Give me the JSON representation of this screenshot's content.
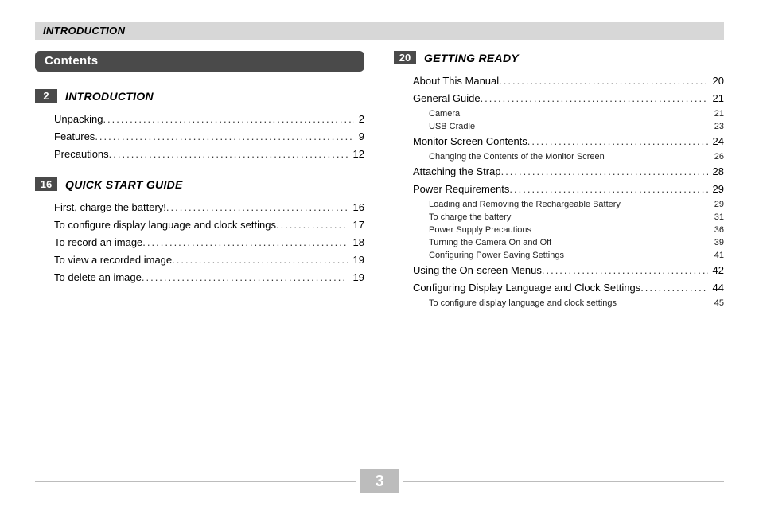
{
  "header": "INTRODUCTION",
  "contents_heading": "Contents",
  "page_number": "3",
  "left_sections": [
    {
      "badge": "2",
      "title": "INTRODUCTION",
      "entries": [
        {
          "label": "Unpacking",
          "page": "2"
        },
        {
          "label": "Features",
          "page": "9"
        },
        {
          "label": "Precautions",
          "page": "12"
        }
      ]
    },
    {
      "badge": "16",
      "title": "QUICK START GUIDE",
      "entries": [
        {
          "label": "First, charge the battery!",
          "page": "16"
        },
        {
          "label": "To configure display language and clock settings",
          "page": "17"
        },
        {
          "label": "To record an image",
          "page": "18"
        },
        {
          "label": "To view a recorded image",
          "page": "19"
        },
        {
          "label": "To delete an image",
          "page": "19"
        }
      ]
    }
  ],
  "right_sections": [
    {
      "badge": "20",
      "title": "GETTING READY",
      "entries": [
        {
          "label": "About This Manual",
          "page": "20"
        },
        {
          "label": "General Guide",
          "page": "21",
          "sub": [
            {
              "label": "Camera",
              "page": "21"
            },
            {
              "label": "USB Cradle",
              "page": "23"
            }
          ]
        },
        {
          "label": "Monitor Screen Contents",
          "page": "24",
          "sub": [
            {
              "label": "Changing the Contents of the Monitor Screen",
              "page": "26"
            }
          ]
        },
        {
          "label": "Attaching the Strap",
          "page": "28"
        },
        {
          "label": "Power Requirements",
          "page": "29",
          "sub": [
            {
              "label": "Loading and Removing the Rechargeable Battery",
              "page": "29"
            },
            {
              "label": "To charge the battery",
              "page": "31"
            },
            {
              "label": "Power Supply Precautions",
              "page": "36"
            },
            {
              "label": "Turning the Camera On and Off",
              "page": "39"
            },
            {
              "label": "Configuring Power Saving Settings",
              "page": "41"
            }
          ]
        },
        {
          "label": "Using the On-screen Menus",
          "page": "42"
        },
        {
          "label": "Configuring Display Language and Clock Settings",
          "page": "44",
          "sub": [
            {
              "label": "To configure display language and clock settings",
              "page": "45"
            }
          ]
        }
      ]
    }
  ]
}
